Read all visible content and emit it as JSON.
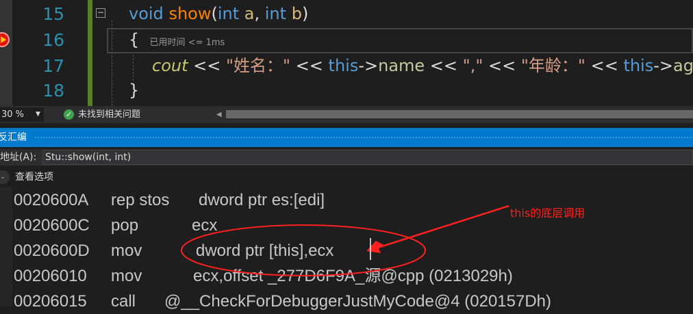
{
  "editor": {
    "line_numbers": [
      "15",
      "16",
      "17",
      "18"
    ],
    "line15": {
      "kw": "void",
      "fn": "show",
      "p1": "(",
      "t1": "int",
      "a": "a",
      ",": ", ",
      "t2": "int",
      "b": "b",
      "p2": ")"
    },
    "line16": {
      "brace": "{",
      "hint": "已用时间 <= 1ms"
    },
    "line17": {
      "cout": "cout",
      "op1": " << ",
      "s1": "\"姓名：\"",
      "op2": " << ",
      "this1": "this",
      "arrow1": "->",
      "name": "name",
      "op3": " << ",
      "s2": "\",\"",
      "op4": " << ",
      "s3": "\"年龄：\"",
      "op5": " << ",
      "this2": "this",
      "arrow2": "->",
      "age": "ag"
    },
    "line18": {
      "brace": "}"
    }
  },
  "status": {
    "zoom": "30 %",
    "issues": "未找到相关问题"
  },
  "disassembly": {
    "title": "反汇编",
    "address_label": "地址(A):",
    "address_value": "Stu::show(int, int)",
    "view_options": "查看选项",
    "rows": [
      {
        "addr": "0020600A",
        "op": "rep stos",
        "args": "dword ptr es:[edi]"
      },
      {
        "addr": "0020600C",
        "op": "pop",
        "args": "ecx"
      },
      {
        "addr": "0020600D",
        "op": "mov",
        "args": "dword ptr [this],ecx"
      },
      {
        "addr": "00206010",
        "op": "mov",
        "args": "ecx,offset _277D6F9A_源@cpp (0213029h)"
      },
      {
        "addr": "00206015",
        "op": "call",
        "args": "@__CheckForDebuggerJustMyCode@4 (020157Dh)"
      }
    ]
  },
  "annotation": {
    "text": "this的底层调用",
    "color": "#ff2020"
  },
  "colors": {
    "accent": "#007acc",
    "keyword": "#569cd6",
    "function": "#ff8000",
    "string": "#d69d85"
  }
}
